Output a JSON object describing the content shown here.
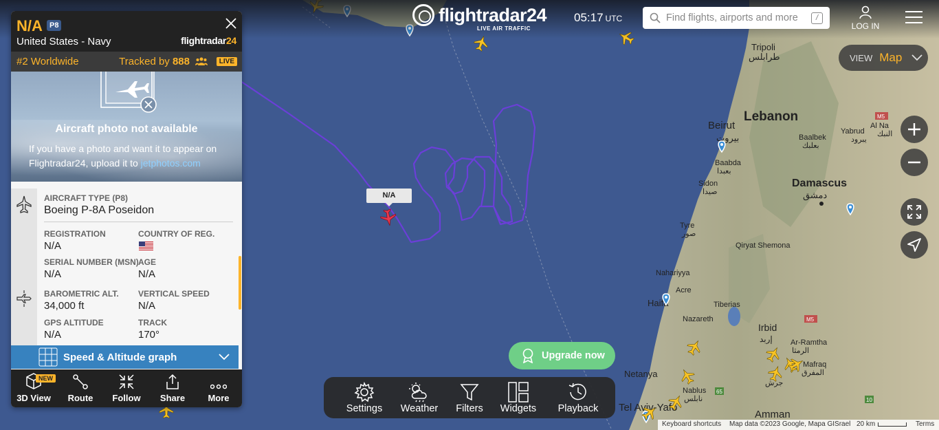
{
  "header": {
    "logo_text": "flightradar24",
    "logo_sub": "LIVE AIR TRAFFIC",
    "time": "05:17",
    "time_zone": "UTC",
    "search_placeholder": "Find flights, airports and more",
    "search_shortcut": "/",
    "login_label": "LOG IN"
  },
  "map_controls": {
    "view_label": "VIEW",
    "view_value": "Map"
  },
  "map": {
    "selected_aircraft_label": "N/A",
    "labels": {
      "tripoli": "Tripoli",
      "tripoli_ar": "طرابلس",
      "lebanon": "Lebanon",
      "beirut": "Beirut",
      "beirut_ar": "بيروت",
      "baabda": "Baabda",
      "baabda_ar": "بعبدا",
      "baalbek": "Baalbek",
      "baalbek_ar": "بعلبك",
      "yabrud": "Yabrud",
      "yabrud_ar": "يبرود",
      "al_nabk": "Al Na",
      "al_nabk_ar": "النبك",
      "damascus": "Damascus",
      "damascus_ar": "دمشق",
      "sidon": "Sidon",
      "sidon_ar": "صيدا",
      "tyre": "Tyre",
      "tyre_ar": "صور",
      "qiryat_shemona": "Qiryat Shemona",
      "nahariyya": "Nahariyya",
      "acre": "Acre",
      "haifa": "Haifa",
      "tiberias": "Tiberias",
      "nazareth": "Nazareth",
      "irbid": "Irbid",
      "irbid_ar": "إربد",
      "ar_ramtha": "Ar-Ramtha",
      "ar_ramtha_ar": "الرمثا",
      "mafraq": "Mafraq",
      "mafraq_ar": "المفرق",
      "jerash_ar": "جرش",
      "netanya": "Netanya",
      "nablus": "Nablus",
      "nablus_ar": "نابلس",
      "tel_aviv": "Tel Aviv-Yafo",
      "amman": "Amman",
      "m5_a": "M5",
      "m5_b": "M5",
      "route_65": "65",
      "route_10": "10"
    }
  },
  "panel": {
    "callsign": "N/A",
    "type_badge": "P8",
    "airline": "United States - Navy",
    "brand_prefix": "flightradar",
    "brand_suffix": "24",
    "rank": "#2 Worldwide",
    "tracked_prefix": "Tracked by",
    "tracked_count": "888",
    "live_badge": "LIVE",
    "photo_title": "Aircraft photo not available",
    "photo_text": "If you have a photo and want it to appear on Flightradar24, upload it to",
    "photo_link": "jetphotos.com",
    "aircraft_type_label": "AIRCRAFT TYPE (P8)",
    "aircraft_type_value": "Boeing P-8A Poseidon",
    "registration_label": "REGISTRATION",
    "registration_value": "N/A",
    "country_label": "COUNTRY OF REG.",
    "serial_label": "SERIAL NUMBER (MSN)",
    "serial_value": "N/A",
    "age_label": "AGE",
    "age_value": "N/A",
    "baro_alt_label": "BAROMETRIC ALT.",
    "baro_alt_value": "34,000 ft",
    "vspeed_label": "VERTICAL SPEED",
    "vspeed_value": "N/A",
    "gps_alt_label": "GPS ALTITUDE",
    "gps_alt_value": "N/A",
    "track_label": "TRACK",
    "track_value": "170°",
    "graph_label": "Speed & Altitude graph",
    "new_badge": "NEW",
    "actions": [
      "3D View",
      "Route",
      "Follow",
      "Share",
      "More"
    ]
  },
  "upgrade_label": "Upgrade now",
  "toolbar": [
    "Settings",
    "Weather",
    "Filters",
    "Widgets",
    "Playback"
  ],
  "footer": {
    "shortcuts": "Keyboard shortcuts",
    "mapdata": "Map data ©2023 Google, Mapa GISrael",
    "scale": "20 km",
    "terms": "Terms"
  },
  "colors": {
    "accent": "#fdb42a",
    "sea": "#3f5a8c",
    "track": "#6b3fd8",
    "upgrade": "#6fcf87",
    "graph_bar": "#3782bf"
  }
}
